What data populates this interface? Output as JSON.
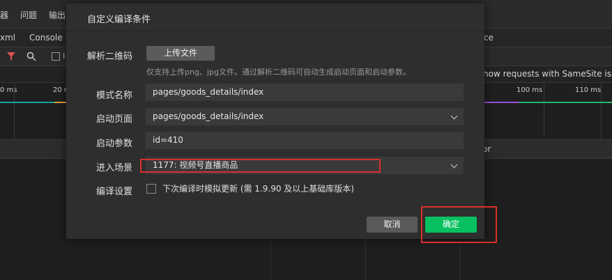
{
  "background": {
    "top_tabs": [
      "器",
      "问题",
      "输出"
    ],
    "sub_tabs": [
      "xml",
      "Console",
      "ce"
    ],
    "samesite_hint": "how requests with SameSite issues",
    "ruler_ticks": [
      "0 ms",
      "20 m",
      "100 ms",
      "110 ms"
    ],
    "header_fragment": "or",
    "filter_checkbox_label": "I"
  },
  "dialog": {
    "title": "自定义编译条件",
    "qr_label": "解析二维码",
    "upload_button": "上传文件",
    "upload_hint": "仅支持上传png、jpg文件。通过解析二维码可自动生成启动页面和启动参数。",
    "mode_name_label": "模式名称",
    "mode_name_value": "pages/goods_details/index",
    "start_page_label": "启动页面",
    "start_page_value": "pages/goods_details/index",
    "start_params_label": "启动参数",
    "start_params_value": "id=410",
    "scene_label": "进入场景",
    "scene_value": "1177: 视频号直播商品",
    "compile_settings_label": "编译设置",
    "compile_checkbox_label": "下次编译时模拟更新 (需 1.9.90 及以上基础库版本)",
    "cancel_button": "取消",
    "confirm_button": "确定"
  },
  "colors": {
    "confirm_green": "#07c160",
    "highlight_red": "#d9302b",
    "filter_icon_red": "#e05252"
  }
}
